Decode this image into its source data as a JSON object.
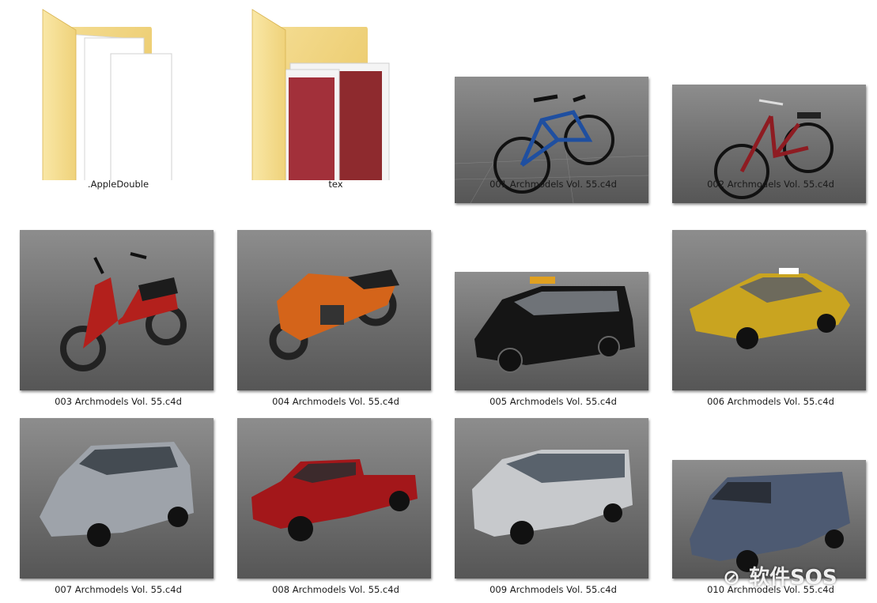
{
  "items": [
    {
      "name": ".AppleDouble",
      "kind": "folder",
      "preview": "documents"
    },
    {
      "name": "tex",
      "kind": "folder",
      "preview": "textures"
    },
    {
      "name": "001 Archmodels Vol. 55.c4d",
      "kind": "file",
      "model": "bicycle",
      "color": "#1f4fa0"
    },
    {
      "name": "002 Archmodels Vol. 55.c4d",
      "kind": "file",
      "model": "bicycle",
      "color": "#8e1c22"
    },
    {
      "name": "003 Archmodels Vol. 55.c4d",
      "kind": "file",
      "model": "scooter",
      "color": "#b3201c"
    },
    {
      "name": "004 Archmodels Vol. 55.c4d",
      "kind": "file",
      "model": "motorcycle",
      "color": "#d4641a"
    },
    {
      "name": "005 Archmodels Vol. 55.c4d",
      "kind": "file",
      "model": "taxi-cab",
      "color": "#151515"
    },
    {
      "name": "006 Archmodels Vol. 55.c4d",
      "kind": "file",
      "model": "sedan-taxi",
      "color": "#c9a420"
    },
    {
      "name": "007 Archmodels Vol. 55.c4d",
      "kind": "file",
      "model": "compact-van",
      "color": "#9ea3aa"
    },
    {
      "name": "008 Archmodels Vol. 55.c4d",
      "kind": "file",
      "model": "pickup-truck",
      "color": "#a3171a"
    },
    {
      "name": "009 Archmodels Vol. 55.c4d",
      "kind": "file",
      "model": "passenger-van",
      "color": "#c7c9cc"
    },
    {
      "name": "010 Archmodels Vol. 55.c4d",
      "kind": "file",
      "model": "cargo-van",
      "color": "#4d5a72"
    }
  ],
  "watermark": {
    "icon": "sos-logo-icon",
    "text": "软件SOS"
  }
}
